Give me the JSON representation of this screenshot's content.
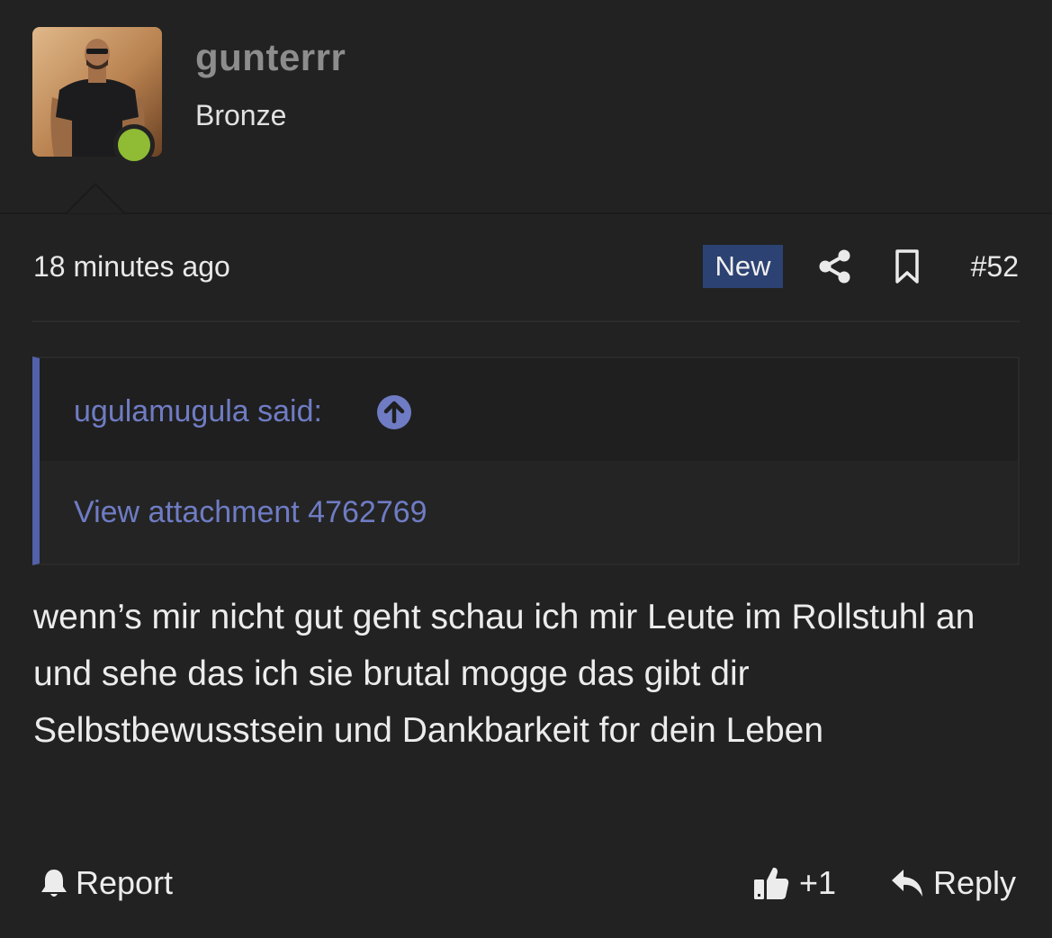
{
  "user": {
    "username": "gunterrr",
    "title": "Bronze",
    "online": true,
    "online_color": "#8fbb35",
    "avatar_icon": "avatar-photo"
  },
  "post": {
    "timestamp": "18 minutes ago",
    "badge": "New",
    "badge_color": "#2c4273",
    "share_icon": "share-icon",
    "bookmark_icon": "bookmark-icon",
    "number": "#52"
  },
  "quote": {
    "author_label": "ugulamugula said:",
    "jump_icon": "arrow-up-circle-icon",
    "attachment_text": "View attachment 4762769",
    "accent_color": "#5261a8"
  },
  "message": {
    "text": "wenn’s mir nicht gut geht schau ich mir Leute im Rollstuhl an und sehe das ich sie brutal mogge das gibt dir Selbstbewusstsein und Dankbarkeit for dein Leben"
  },
  "footer": {
    "report_label": "Report",
    "like_count": "+1",
    "reply_label": "Reply"
  }
}
